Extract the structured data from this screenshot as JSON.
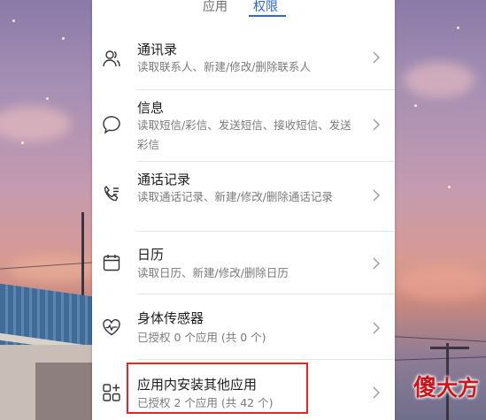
{
  "tabs": [
    {
      "label": "应用",
      "active": false
    },
    {
      "label": "权限",
      "active": true
    }
  ],
  "permissions": [
    {
      "icon": "contacts-icon",
      "title": "通讯录",
      "desc": "读取联系人、新建/修改/删除联系人"
    },
    {
      "icon": "message-icon",
      "title": "信息",
      "desc": "读取短信/彩信、发送短信、接收短信、发送彩信"
    },
    {
      "icon": "call-log-icon",
      "title": "通话记录",
      "desc": "读取通话记录、新建/修改/删除通话记录"
    },
    {
      "icon": "calendar-icon",
      "title": "日历",
      "desc": "读取日历、新建/修改/删除日历"
    },
    {
      "icon": "body-sensors-icon",
      "title": "身体传感器",
      "desc": "已授权 0 个应用 (共 0 个)"
    },
    {
      "icon": "install-apps-icon",
      "title": "应用内安装其他应用",
      "desc": "已授权 2 个应用 (共 42 个)",
      "highlighted": true
    }
  ],
  "watermark": {
    "first": "傻",
    "rest": "大方"
  },
  "colors": {
    "accent": "#2d68d6",
    "highlight": "#e5252a"
  }
}
